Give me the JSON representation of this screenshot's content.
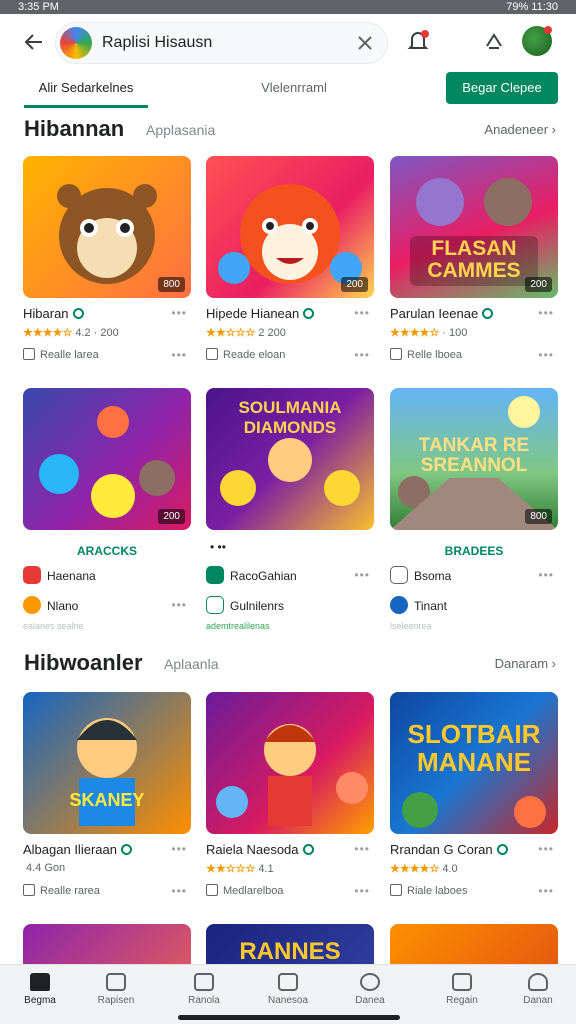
{
  "status": {
    "left": "3:35 PM",
    "right": "79% 11:30"
  },
  "topbar": {
    "search_text": "Raplisi Hisausn"
  },
  "tabs": {
    "tab1": "Alir Sedarkelnes",
    "tab2": "Vlelenrraml",
    "button": "Begar Clepee"
  },
  "section1": {
    "title": "Hibannan",
    "subtitle": "Applasania",
    "more": "Anadeneer"
  },
  "row1": [
    {
      "title": "Hibaran",
      "stars": "★★★★☆",
      "meta": "4.2 · 200",
      "row": "Realle larea",
      "badge": "800"
    },
    {
      "title": "Hipede Hianean",
      "stars": "★★☆☆☆",
      "meta": "2 200",
      "row": "Reade eloan",
      "badge": "200"
    },
    {
      "title": "Parulan Ieenae",
      "stars": "★★★★☆",
      "meta": "· 100",
      "row": "Relle lboea",
      "badge": "200",
      "art": "FLASAN CAMMES"
    }
  ],
  "row2": [
    {
      "header": "ARACCKS",
      "items": [
        "Haenana",
        "Nlano"
      ],
      "faint": "ealanes sealne",
      "badge": "200",
      "art": ""
    },
    {
      "header": "",
      "items": [
        "RacoGahian",
        "Gulnilenrs"
      ],
      "faint": "ademtrealilenas",
      "badge": "",
      "art": "SOULMANIA DIAMONDS"
    },
    {
      "header": "BRADEES",
      "items": [
        "Bsoma",
        "Tinant"
      ],
      "faint": "lseleenrea",
      "badge": "800",
      "art": "TANKAR RE SREANNOL"
    }
  ],
  "section2": {
    "title": "Hibwoanler",
    "subtitle": "Aplaanla",
    "more": "Danaram"
  },
  "row3": [
    {
      "title": "Albagan Ilieraan",
      "meta": "4.4 Gon",
      "row": "Realle rarea",
      "art": "SKANEY",
      "stars": "★★★★★"
    },
    {
      "title": "Raiela Naesoda",
      "stars": "★★☆☆☆",
      "meta": "4.1",
      "row": "Medlarelboa",
      "art": ""
    },
    {
      "title": "Rrandan G Coran",
      "stars": "★★★★☆",
      "meta": "4.0",
      "row": "Riale laboes",
      "art": "SLOTBAIR MANANE"
    }
  ],
  "row4": [
    {
      "art": ""
    },
    {
      "art": "RANNES"
    },
    {
      "art": ""
    }
  ],
  "nav": [
    "Begma",
    "Rapisen",
    "Ranola",
    "Nanesoa",
    "Danea",
    "Regain",
    "Danan"
  ],
  "colors": {
    "accent": "#01875f",
    "star": "#f29900"
  }
}
